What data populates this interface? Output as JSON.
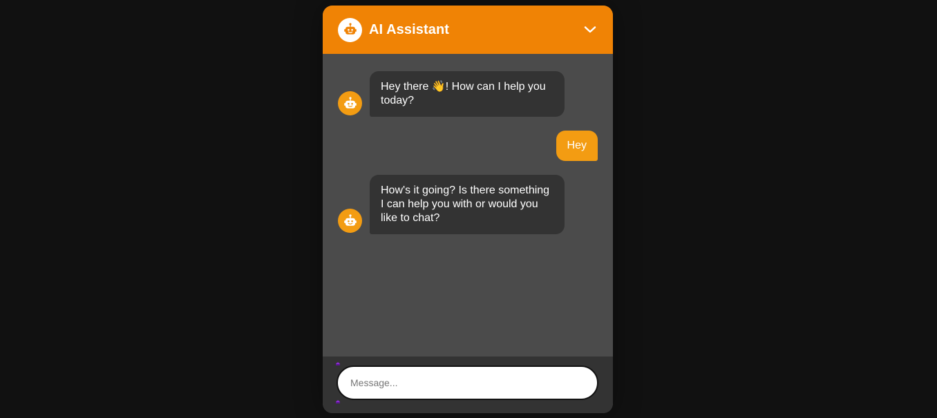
{
  "header": {
    "title": "AI Assistant",
    "logo_icon": "robot-icon",
    "toggle_icon": "chevron-down-icon",
    "background": "#f08305"
  },
  "messages": [
    {
      "sender": "bot",
      "text": "Hey there 👋! How can I help you today?"
    },
    {
      "sender": "user",
      "text": "Hey"
    },
    {
      "sender": "bot",
      "text": "How's it going? Is there something I can help you with or would you like to chat?"
    }
  ],
  "input": {
    "placeholder": "Message...",
    "value": ""
  },
  "colors": {
    "accent": "#f39c12",
    "bot_bubble": "#333333",
    "chat_background": "#4b4b4b",
    "page_background": "#111111"
  }
}
